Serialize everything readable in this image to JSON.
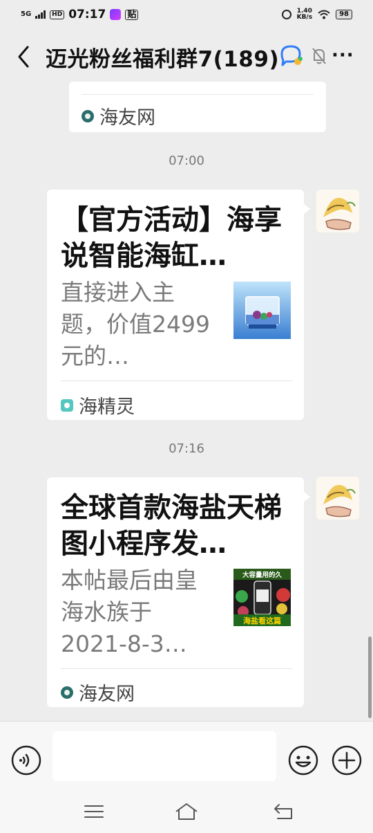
{
  "status_bar": {
    "network": "5G",
    "hd": "HD",
    "time": "07:17",
    "tie_label": "贴",
    "speed_value": "1.40",
    "speed_unit": "KB/s",
    "battery": "98"
  },
  "header": {
    "title": "迈光粉丝福利群7(189)",
    "more": "···"
  },
  "messages": {
    "prev_card": {
      "source": "海友网"
    },
    "time1": "07:00",
    "msg1": {
      "title": "【官方活动】海享说智能海缸…",
      "desc": "直接进入主题，价值2499元的…",
      "source": "海精灵"
    },
    "time2": "07:16",
    "msg2": {
      "title": "全球首款海盐天梯图小程序发…",
      "desc": "本帖最后由皇海水族于2021-8-3…",
      "source": "海友网",
      "thumb_text_top": "大容量用的久",
      "thumb_text_bottom": "海盐看这篇"
    }
  },
  "input_bar": {
    "placeholder": ""
  },
  "colors": {
    "background": "#ededed",
    "card": "#ffffff",
    "secondary_text": "#7a7a7a"
  }
}
